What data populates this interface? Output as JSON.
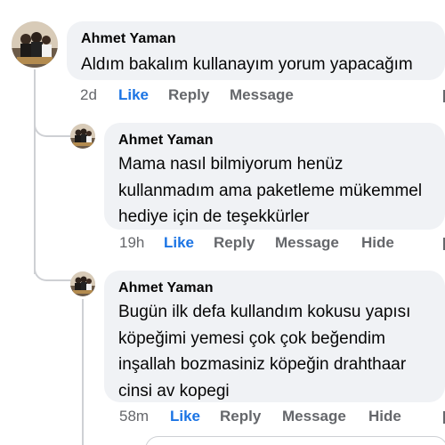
{
  "comments": [
    {
      "author": "Ahmet Yaman",
      "lines": [
        "Aldım bakalım kullanayım yorum yapacağım"
      ],
      "time": "2d",
      "like": "Like",
      "reply": "Reply",
      "message": "Message"
    },
    {
      "author": "Ahmet Yaman",
      "lines": [
        "Mama nasıl bilmiyorum henüz",
        "kullanmadım ama paketleme mükemmel",
        "hediye için de teşekkürler"
      ],
      "time": "19h",
      "like": "Like",
      "reply": "Reply",
      "message": "Message",
      "hide": "Hide"
    },
    {
      "author": "Ahmet Yaman",
      "lines": [
        "Bugün ilk defa kullandım kokusu yapısı",
        "köpeğimi yemesi çok çok beğendim",
        "inşallah bozmasiniz köpeğin drahthaar",
        "cinsi av kopegi"
      ],
      "time": "58m",
      "like": "Like",
      "reply": "Reply",
      "message": "Message",
      "hide": "Hide"
    }
  ],
  "colors": {
    "bubble": "#f0f2f5",
    "like": "#1b74e4",
    "meta": "#65676b",
    "text": "#050505",
    "thread_line": "#ced0d4"
  }
}
